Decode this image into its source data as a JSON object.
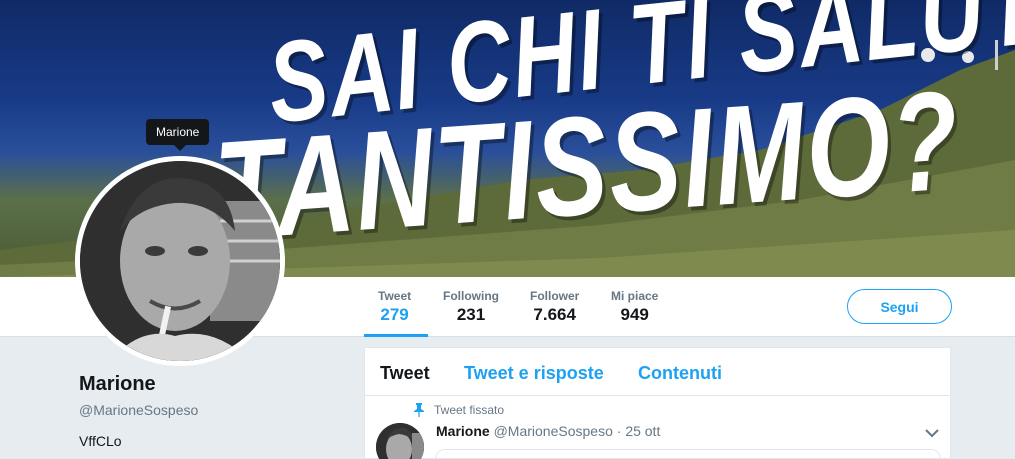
{
  "banner": {
    "line1": "SAI CHI TI SALUTA",
    "line2": "TANTISSIMO?"
  },
  "tooltip": "Marione",
  "stats": [
    {
      "label": "Tweet",
      "value": "279",
      "active": true
    },
    {
      "label": "Following",
      "value": "231",
      "active": false
    },
    {
      "label": "Follower",
      "value": "7.664",
      "active": false
    },
    {
      "label": "Mi piace",
      "value": "949",
      "active": false
    }
  ],
  "follow_button": "Segui",
  "profile": {
    "name": "Marione",
    "handle": "@MarioneSospeso",
    "bio": "VffCLo"
  },
  "tabs": [
    {
      "label": "Tweet",
      "active": true
    },
    {
      "label": "Tweet e risposte",
      "active": false
    },
    {
      "label": "Contenuti",
      "active": false
    }
  ],
  "pinned_tweet": {
    "pinned_label": "Tweet fissato",
    "author_name": "Marione",
    "author_handle": "@MarioneSospeso",
    "separator": "·",
    "time": "25 ott"
  },
  "icons": {
    "pin": "pin-icon",
    "caret": "chevron-down-icon"
  },
  "colors": {
    "accent": "#1da1f2",
    "text": "#14171a",
    "muted": "#657786",
    "background": "#e6ecf0"
  }
}
